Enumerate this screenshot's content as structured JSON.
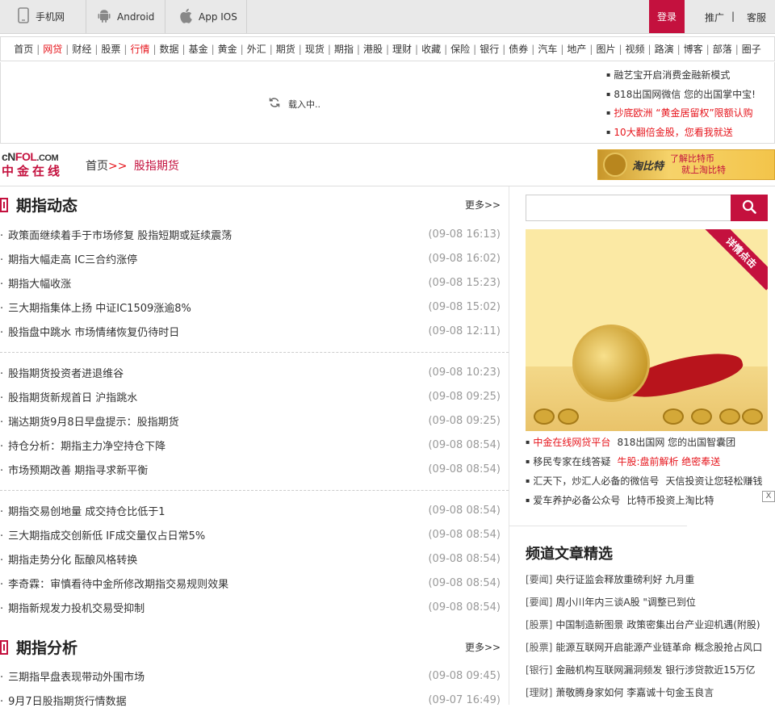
{
  "topbar": {
    "mobile": "手机网",
    "android": "Android",
    "ios": "App IOS",
    "login": "登录",
    "promo": "推广",
    "sep": "|",
    "service": "客服"
  },
  "nav": [
    {
      "label": "首页",
      "red": false
    },
    {
      "label": "网贷",
      "red": true
    },
    {
      "label": "财经",
      "red": false
    },
    {
      "label": "股票",
      "red": false
    },
    {
      "label": "行情",
      "red": true
    },
    {
      "label": "数据",
      "red": false
    },
    {
      "label": "基金",
      "red": false
    },
    {
      "label": "黄金",
      "red": false
    },
    {
      "label": "外汇",
      "red": false
    },
    {
      "label": "期货",
      "red": false
    },
    {
      "label": "现货",
      "red": false
    },
    {
      "label": "期指",
      "red": false
    },
    {
      "label": "港股",
      "red": false
    },
    {
      "label": "理财",
      "red": false
    },
    {
      "label": "收藏",
      "red": false
    },
    {
      "label": "保险",
      "red": false
    },
    {
      "label": "银行",
      "red": false
    },
    {
      "label": "债券",
      "red": false
    },
    {
      "label": "汽车",
      "red": false
    },
    {
      "label": "地产",
      "red": false
    },
    {
      "label": "图片",
      "red": false
    },
    {
      "label": "视频",
      "red": false
    },
    {
      "label": "路演",
      "red": false
    },
    {
      "label": "博客",
      "red": false
    },
    {
      "label": "部落",
      "red": false
    },
    {
      "label": "圈子",
      "red": false
    }
  ],
  "nav_sep": "|",
  "banner": {
    "loading": "载入中..",
    "links": [
      {
        "text": "融艺宝开启消费金融新模式",
        "red": false
      },
      {
        "text": "818出国网微信 您的出国掌中宝!",
        "red": false
      },
      {
        "text": "抄底欧洲 “黄金居留权”限额认购",
        "red": true
      },
      {
        "text": "10大翻倍金股，您看我就送",
        "red": true
      }
    ]
  },
  "logo": {
    "line1a": "cN",
    "line1b": "FOL",
    "line1c": ".COM",
    "line2": "中金在线"
  },
  "breadcrumb": {
    "home": "首页",
    "gt": ">>",
    "current": "股指期货"
  },
  "ad_small": {
    "brand": "淘比特",
    "line1": "了解比特币",
    "line2": "就上淘比特"
  },
  "sections": [
    {
      "title": "期指动态",
      "more": "更多>>",
      "groups": [
        [
          {
            "t": "政策面继续着手于市场修复 股指短期或延续震荡",
            "d": "(09-08 16:13)"
          },
          {
            "t": "期指大幅走高 IC三合约涨停",
            "d": "(09-08 16:02)"
          },
          {
            "t": "期指大幅收涨",
            "d": "(09-08 15:23)"
          },
          {
            "t": "三大期指集体上扬 中证IC1509涨逾8%",
            "d": "(09-08 15:02)"
          },
          {
            "t": "股指盘中跳水 市场情绪恢复仍待时日",
            "d": "(09-08 12:11)"
          }
        ],
        [
          {
            "t": "股指期货投资者进退维谷",
            "d": "(09-08 10:23)"
          },
          {
            "t": "股指期货新规首日 沪指跳水",
            "d": "(09-08 09:25)"
          },
          {
            "t": "瑞达期货9月8日早盘提示：股指期货",
            "d": "(09-08 09:25)"
          },
          {
            "t": "持仓分析：期指主力净空持仓下降",
            "d": "(09-08 08:54)"
          },
          {
            "t": "市场预期改善 期指寻求新平衡",
            "d": "(09-08 08:54)"
          }
        ],
        [
          {
            "t": "期指交易创地量 成交持仓比低于1",
            "d": "(09-08 08:54)"
          },
          {
            "t": "三大期指成交创新低 IF成交量仅占日常5%",
            "d": "(09-08 08:54)"
          },
          {
            "t": "期指走势分化 酝酿风格转换",
            "d": "(09-08 08:54)"
          },
          {
            "t": "李奇霖：审慎看待中金所修改期指交易规则效果",
            "d": "(09-08 08:54)"
          },
          {
            "t": "期指新规发力投机交易受抑制",
            "d": "(09-08 08:54)"
          }
        ]
      ]
    },
    {
      "title": "期指分析",
      "more": "更多>>",
      "groups": [
        [
          {
            "t": "三期指早盘表现带动外围市场",
            "d": "(09-08 09:45)"
          },
          {
            "t": "9月7日股指期货行情数据",
            "d": "(09-07 16:49)"
          }
        ]
      ]
    }
  ],
  "search": {
    "placeholder": ""
  },
  "bigad": {
    "ribbon": "详情点击"
  },
  "adlinks": [
    [
      {
        "text": "中金在线网贷平台",
        "red": true
      },
      {
        "text": "818出国网 您的出国智囊团",
        "red": false
      }
    ],
    [
      {
        "text": "移民专家在线答疑",
        "red": false
      },
      {
        "text": "牛股:盘前解析 绝密奉送",
        "red": true
      }
    ],
    [
      {
        "text": "汇天下，炒汇人必备的微信号",
        "red": false
      },
      {
        "text": "天信投资让您轻松赚钱",
        "red": false
      }
    ],
    [
      {
        "text": "爱车养护必备公众号",
        "red": false
      },
      {
        "text": "比特币投资上淘比特",
        "red": false
      }
    ]
  ],
  "close_label": "X",
  "jingxuan": {
    "title": "频道文章精选",
    "items": [
      {
        "tag": "[要闻]",
        "text": "央行证监会释放重磅利好 九月重"
      },
      {
        "tag": "[要闻]",
        "text": "周小川年内三谈A股 \"调整已到位"
      },
      {
        "tag": "[股票]",
        "text": "中国制造新图景 政策密集出台产业迎机遇(附股)"
      },
      {
        "tag": "[股票]",
        "text": "能源互联网开启能源产业链革命 概念股抢占风口"
      },
      {
        "tag": "[银行]",
        "text": "金融机构互联网漏洞频发 银行涉贷款近15万亿"
      },
      {
        "tag": "[理财]",
        "text": "萧敬腾身家如何 李嘉诚十句金玉良言"
      }
    ]
  },
  "colors": {
    "brand": "#c4113e",
    "link_red": "#e6151c",
    "date_gray": "#999999"
  }
}
